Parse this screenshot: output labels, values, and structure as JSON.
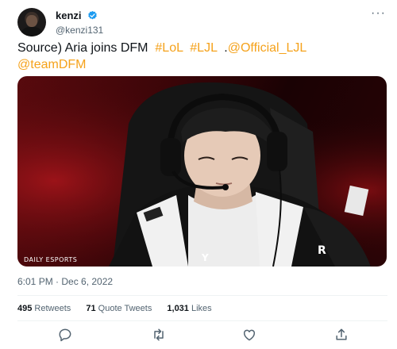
{
  "author": {
    "display_name": "kenzi",
    "handle": "@kenzi131"
  },
  "tweet": {
    "text_segments": [
      {
        "text": "Source) Aria joins DFM  ",
        "type": "plain"
      },
      {
        "text": "#LoL",
        "type": "link"
      },
      {
        "text": "  ",
        "type": "plain"
      },
      {
        "text": "#LJL",
        "type": "link"
      },
      {
        "text": "  .",
        "type": "plain"
      },
      {
        "text": "@Official_LJL",
        "type": "link"
      },
      {
        "text": "@teamDFM",
        "type": "link"
      }
    ],
    "media_watermark": "DAILY ESPORTS",
    "timestamp": "6:01 PM · Dec 6, 2022"
  },
  "stats": {
    "retweets_count": "495",
    "retweets_label": "Retweets",
    "quotes_count": "71",
    "quotes_label": "Quote Tweets",
    "likes_count": "1,031",
    "likes_label": "Likes"
  },
  "colors": {
    "link": "#f5a21b",
    "verified": "#1d9bf0",
    "muted": "#536471"
  },
  "icons": [
    "more-icon",
    "verified-icon",
    "reply-icon",
    "retweet-icon",
    "like-icon",
    "share-icon"
  ]
}
